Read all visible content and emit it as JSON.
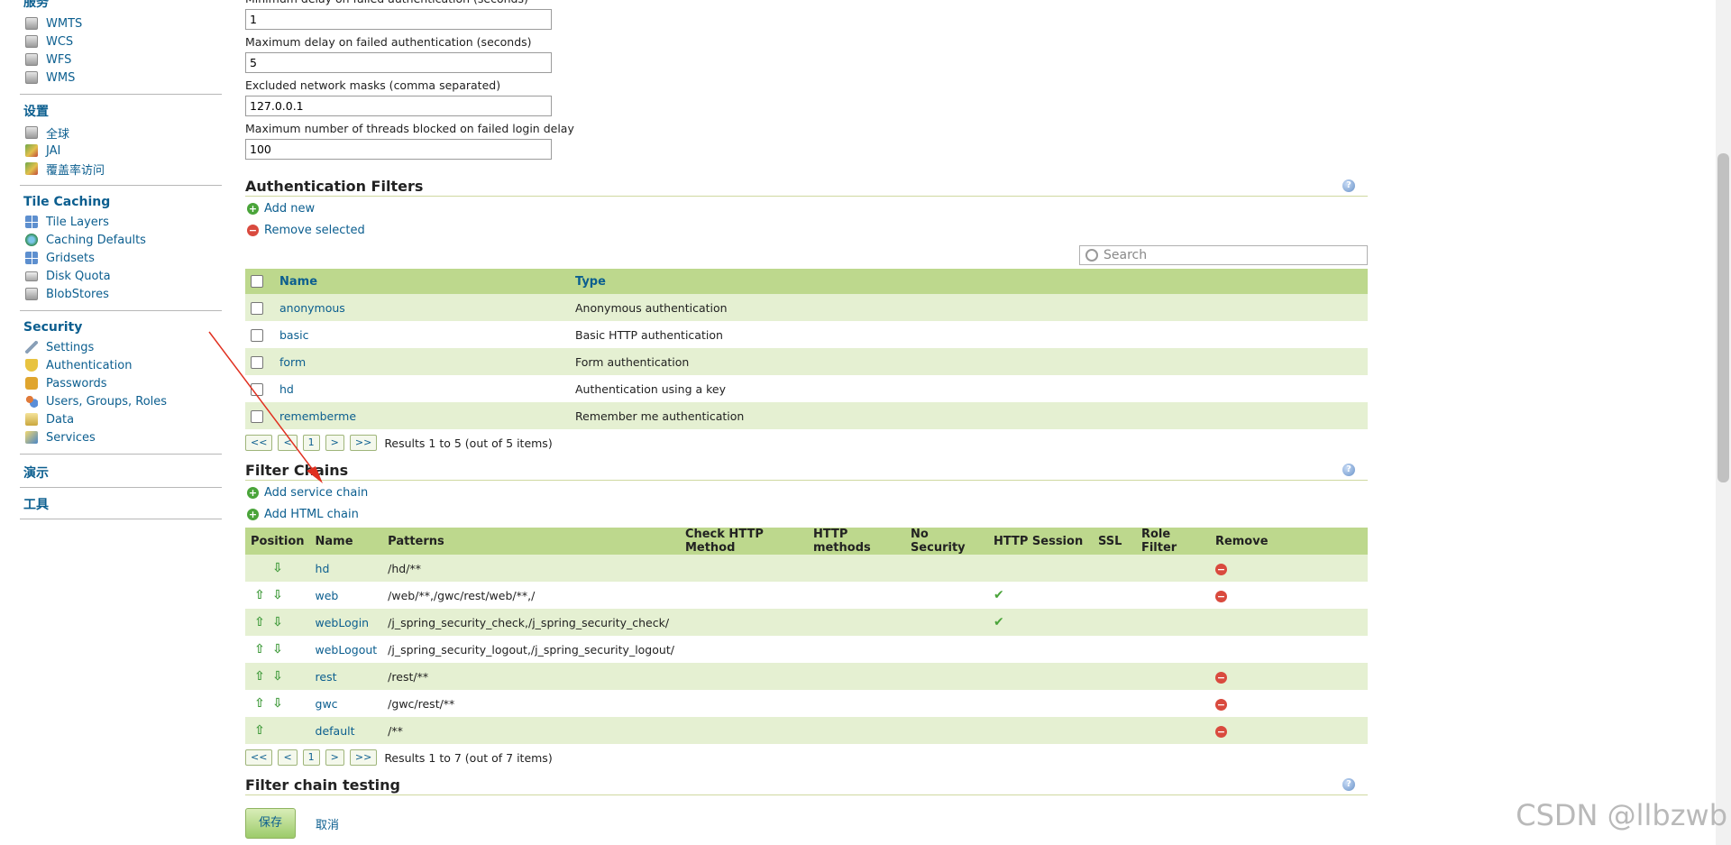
{
  "sidebar": {
    "sections": [
      {
        "title": "服务",
        "items": [
          {
            "label": "WMTS",
            "icon": "gray"
          },
          {
            "label": "WCS",
            "icon": "gray"
          },
          {
            "label": "WFS",
            "icon": "gray"
          },
          {
            "label": "WMS",
            "icon": "gray"
          }
        ]
      },
      {
        "title": "设置",
        "items": [
          {
            "label": "全球",
            "icon": "gray"
          },
          {
            "label": "JAI",
            "icon": "map"
          },
          {
            "label": "覆盖率访问",
            "icon": "map"
          }
        ]
      },
      {
        "title": "Tile Caching",
        "items": [
          {
            "label": "Tile Layers",
            "icon": "grid"
          },
          {
            "label": "Caching Defaults",
            "icon": "globe"
          },
          {
            "label": "Gridsets",
            "icon": "grid"
          },
          {
            "label": "Disk Quota",
            "icon": "disk"
          },
          {
            "label": "BlobStores",
            "icon": "gray"
          }
        ]
      },
      {
        "title": "Security",
        "items": [
          {
            "label": "Settings",
            "icon": "wrench"
          },
          {
            "label": "Authentication",
            "icon": "shield"
          },
          {
            "label": "Passwords",
            "icon": "lock"
          },
          {
            "label": "Users, Groups, Roles",
            "icon": "users"
          },
          {
            "label": "Data",
            "icon": "data"
          },
          {
            "label": "Services",
            "icon": "svc"
          }
        ]
      },
      {
        "title": "演示",
        "items": []
      },
      {
        "title": "工具",
        "items": []
      }
    ]
  },
  "fields": [
    {
      "label": "Minimum delay on failed authentication (seconds)",
      "value": "1"
    },
    {
      "label": "Maximum delay on failed authentication (seconds)",
      "value": "5"
    },
    {
      "label": "Excluded network masks (comma separated)",
      "value": "127.0.0.1"
    },
    {
      "label": "Maximum number of threads blocked on failed login delay",
      "value": "100"
    }
  ],
  "auth_filters": {
    "title": "Authentication Filters",
    "add_new": "Add new",
    "remove_selected": "Remove selected",
    "search_placeholder": "Search",
    "columns": [
      "Name",
      "Type"
    ],
    "rows": [
      {
        "name": "anonymous",
        "type": "Anonymous authentication"
      },
      {
        "name": "basic",
        "type": "Basic HTTP authentication"
      },
      {
        "name": "form",
        "type": "Form authentication"
      },
      {
        "name": "hd",
        "type": "Authentication using a key"
      },
      {
        "name": "rememberme",
        "type": "Remember me authentication"
      }
    ],
    "pager": {
      "first": "<<",
      "prev": "<",
      "page": "1",
      "next": ">",
      "last": ">>",
      "results": "Results 1 to 5 (out of 5 items)"
    }
  },
  "filter_chains": {
    "title": "Filter Chains",
    "add_service": "Add service chain",
    "add_html": "Add HTML chain",
    "columns": [
      "Position",
      "Name",
      "Patterns",
      "Check HTTP Method",
      "HTTP methods",
      "No Security",
      "HTTP Session",
      "SSL",
      "Role Filter",
      "Remove"
    ],
    "rows": [
      {
        "up": false,
        "down": true,
        "name": "hd",
        "patterns": "/hd/**",
        "session": false,
        "remove": true
      },
      {
        "up": true,
        "down": true,
        "name": "web",
        "patterns": "/web/**,/gwc/rest/web/**,/",
        "session": true,
        "remove": true
      },
      {
        "up": true,
        "down": true,
        "name": "webLogin",
        "patterns": "/j_spring_security_check,/j_spring_security_check/",
        "session": true,
        "remove": false
      },
      {
        "up": true,
        "down": true,
        "name": "webLogout",
        "patterns": "/j_spring_security_logout,/j_spring_security_logout/",
        "session": false,
        "remove": false
      },
      {
        "up": true,
        "down": true,
        "name": "rest",
        "patterns": "/rest/**",
        "session": false,
        "remove": true
      },
      {
        "up": true,
        "down": true,
        "name": "gwc",
        "patterns": "/gwc/rest/**",
        "session": false,
        "remove": true
      },
      {
        "up": true,
        "down": false,
        "name": "default",
        "patterns": "/**",
        "session": false,
        "remove": true
      }
    ],
    "pager": {
      "first": "<<",
      "prev": "<",
      "page": "1",
      "next": ">",
      "last": ">>",
      "results": "Results 1 to 7 (out of 7 items)"
    }
  },
  "testing_title": "Filter chain testing",
  "buttons": {
    "save": "保存",
    "cancel": "取消"
  },
  "watermark": "CSDN @llbzwb",
  "glyphs": {
    "up": "⇧",
    "down": "⇩",
    "check": "✔",
    "remove": "−",
    "add": "+",
    "help": "?"
  },
  "colors": {
    "header_green": "#bdd88d",
    "row_alt": "#e5f0d2",
    "link": "#0b5e8f",
    "annotation_arrow": "#e03020"
  }
}
